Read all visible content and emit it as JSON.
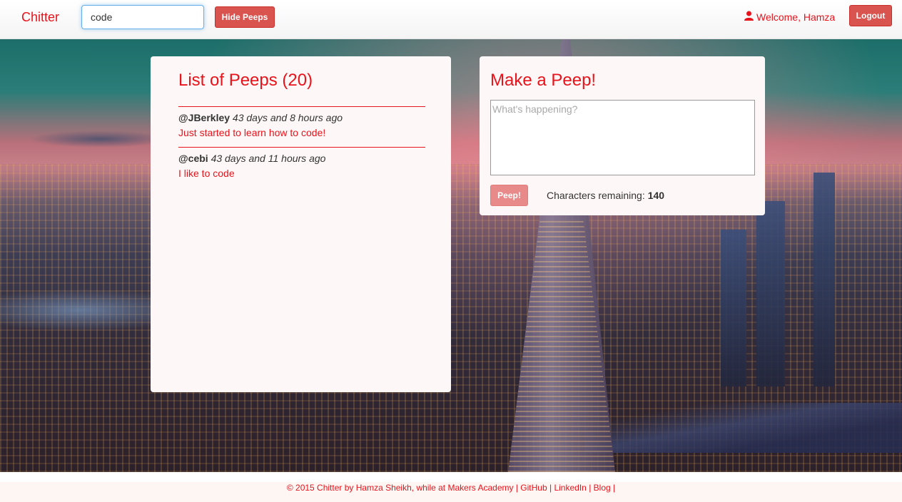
{
  "navbar": {
    "brand": "Chitter",
    "search_value": "code",
    "hide_button": "Hide Peeps",
    "welcome": "Welcome, Hamza",
    "logout_button": "Logout",
    "user_icon": "user-icon"
  },
  "peeps_panel": {
    "title": "List of Peeps (20)",
    "peeps": [
      {
        "author": "@JBerkley",
        "time": "43 days and 8 hours ago",
        "text": "Just started to learn how to code!"
      },
      {
        "author": "@cebi",
        "time": "43 days and 11 hours ago",
        "text": "I like to code"
      }
    ]
  },
  "make_panel": {
    "title": "Make a Peep!",
    "placeholder": "What's happening?",
    "button": "Peep!",
    "chars_label": "Characters remaining:",
    "chars_value": "140"
  },
  "footer": {
    "text": "© 2015 Chitter by Hamza Sheikh, while at Makers Academy |",
    "github": "GitHub",
    "sep1": "|",
    "linkedin": "LinkedIn",
    "sep2": "|",
    "blog": "Blog",
    "sep3": "|"
  },
  "colors": {
    "accent": "#e8131b",
    "button": "#d9534f",
    "panel": "#fdf8f7"
  }
}
